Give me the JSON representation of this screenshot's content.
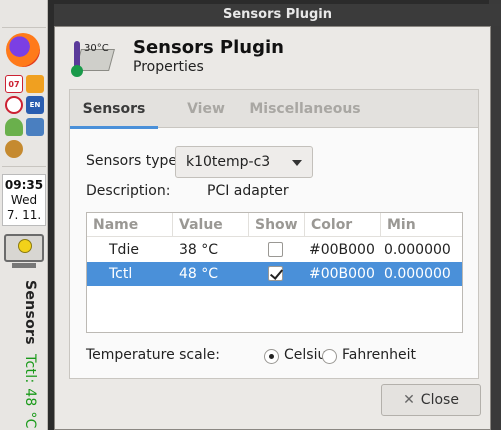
{
  "panel": {
    "clock": {
      "time": "09:35",
      "day": "Wed",
      "date": "7. 11."
    },
    "sensors_label": "Sensors",
    "sensor_value": "Tctl: 48 °C",
    "calendar_icon_text": "07"
  },
  "window": {
    "title": "Sensors Plugin"
  },
  "header": {
    "title": "Sensors Plugin",
    "subtitle": "Properties",
    "icon_temp": "30°C"
  },
  "tabs": [
    {
      "label": "Sensors",
      "active": true
    },
    {
      "label": "View",
      "active": false
    },
    {
      "label": "Miscellaneous",
      "active": false
    }
  ],
  "sensors": {
    "type_label": "Sensors type:",
    "type_value": "k10temp-c3",
    "description_label": "Description:",
    "description_value": "PCI adapter",
    "columns": [
      "Name",
      "Value",
      "Show",
      "Color",
      "Min"
    ],
    "rows": [
      {
        "name": "Tdie",
        "value": "38 °C",
        "show": false,
        "color": "#00B000",
        "min": "0.000000",
        "selected": false
      },
      {
        "name": "Tctl",
        "value": "48 °C",
        "show": true,
        "color": "#00B000",
        "min": "0.000000",
        "selected": true
      }
    ]
  },
  "temperature": {
    "label": "Temperature scale:",
    "options": [
      {
        "label": "Celsius",
        "checked": true
      },
      {
        "label": "Fahrenheit",
        "checked": false
      }
    ]
  },
  "buttons": {
    "close": "Close"
  },
  "colors": {
    "selection": "#4a90d9",
    "sensor_text": "#1a9a1a"
  }
}
